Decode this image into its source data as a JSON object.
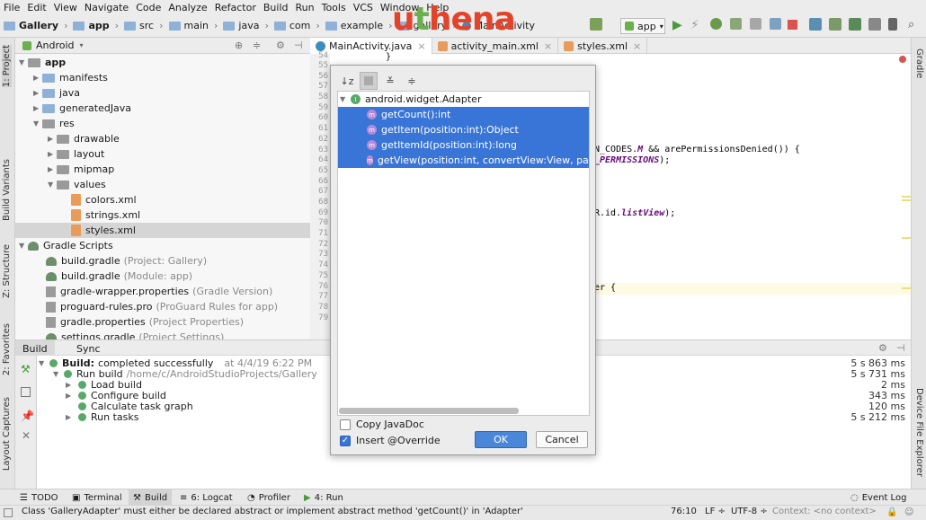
{
  "menu": [
    "File",
    "Edit",
    "View",
    "Navigate",
    "Code",
    "Analyze",
    "Refactor",
    "Build",
    "Run",
    "Tools",
    "VCS",
    "Window",
    "Help"
  ],
  "breadcrumbs": [
    "Gallery",
    "app",
    "src",
    "main",
    "java",
    "com",
    "example",
    "gallery",
    "MainActivity"
  ],
  "logo": {
    "text_main": "u",
    "text_t": "t",
    "text_rest": "hena"
  },
  "toolbar": {
    "run_config": "app"
  },
  "left_strip": {
    "project": "1: Project",
    "build_variants": "Build Variants",
    "structure": "Z: Structure",
    "favorites": "2: Favorites",
    "layout_captures": "Layout Captures"
  },
  "right_strip": {
    "gradle": "Gradle",
    "device_file_explorer": "Device File Explorer"
  },
  "project_panel": {
    "view_selector": "Android",
    "tree": [
      {
        "label": "app",
        "hint": "",
        "icon": "folder",
        "bold": true
      },
      {
        "label": "manifests",
        "hint": "",
        "icon": "folder"
      },
      {
        "label": "java",
        "hint": "",
        "icon": "folder"
      },
      {
        "label": "generatedJava",
        "hint": "",
        "icon": "folder"
      },
      {
        "label": "res",
        "hint": "",
        "icon": "folder"
      },
      {
        "label": "drawable",
        "hint": "",
        "icon": "folder"
      },
      {
        "label": "layout",
        "hint": "",
        "icon": "folder"
      },
      {
        "label": "mipmap",
        "hint": "",
        "icon": "folder"
      },
      {
        "label": "values",
        "hint": "",
        "icon": "folder"
      },
      {
        "label": "colors.xml",
        "hint": "",
        "icon": "xml"
      },
      {
        "label": "strings.xml",
        "hint": "",
        "icon": "xml"
      },
      {
        "label": "styles.xml",
        "hint": "",
        "icon": "xml"
      },
      {
        "label": "Gradle Scripts",
        "hint": "",
        "icon": "gradle"
      },
      {
        "label": "build.gradle",
        "hint": "(Project: Gallery)",
        "icon": "gradle"
      },
      {
        "label": "build.gradle",
        "hint": "(Module: app)",
        "icon": "gradle"
      },
      {
        "label": "gradle-wrapper.properties",
        "hint": "(Gradle Version)",
        "icon": "prop"
      },
      {
        "label": "proguard-rules.pro",
        "hint": "(ProGuard Rules for app)",
        "icon": "prop"
      },
      {
        "label": "gradle.properties",
        "hint": "(Project Properties)",
        "icon": "prop"
      },
      {
        "label": "settings.gradle",
        "hint": "(Project Settings)",
        "icon": "gradle"
      }
    ]
  },
  "editor_tabs": [
    {
      "label": "MainActivity.java",
      "active": true
    },
    {
      "label": "activity_main.xml",
      "active": false
    },
    {
      "label": "styles.xml",
      "active": false
    }
  ],
  "line_numbers": [
    "54",
    "55",
    "56",
    "57",
    "58",
    "59",
    "60",
    "61",
    "62",
    "63",
    "64",
    "65",
    "66",
    "67",
    "68",
    "69",
    "70",
    "71",
    "72",
    "73",
    "74",
    "75",
    "76",
    "77",
    "78",
    "79"
  ],
  "code": {
    "brace": "}",
    "line62a": "N_CODES.",
    "line62b": "M",
    "line62c": " && arePermissionsDenied()) {",
    "line63a": "_PERMISSIONS",
    "line63b": ");",
    "line67a": "R.id.",
    "line67b": "listView",
    "line67c": ");",
    "line76": "er {"
  },
  "dialog": {
    "class_name": "android.widget.Adapter",
    "methods": [
      "getCount():int",
      "getItem(position:int):Object",
      "getItemId(position:int):long",
      "getView(position:int, convertView:View, parent:ViewGroup):View"
    ],
    "copy_javadoc": "Copy JavaDoc",
    "insert_override": "Insert @Override",
    "ok": "OK",
    "cancel": "Cancel"
  },
  "build_panel": {
    "tabs": [
      "Build",
      "Sync"
    ],
    "rows": [
      {
        "label": "Build:",
        "detail": "completed successfully",
        "extra": "at 4/4/19 6:22 PM",
        "time": "5 s 863 ms"
      },
      {
        "label": "Run build",
        "detail": "/home/c/AndroidStudioProjects/Gallery",
        "extra": "",
        "time": "5 s 731 ms"
      },
      {
        "label": "Load build",
        "detail": "",
        "extra": "",
        "time": "2 ms"
      },
      {
        "label": "Configure build",
        "detail": "",
        "extra": "",
        "time": "343 ms"
      },
      {
        "label": "Calculate task graph",
        "detail": "",
        "extra": "",
        "time": "120 ms"
      },
      {
        "label": "Run tasks",
        "detail": "",
        "extra": "",
        "time": "5 s 212 ms"
      }
    ]
  },
  "tool_windows": [
    {
      "label": "TODO"
    },
    {
      "label": "Terminal"
    },
    {
      "label": "Build"
    },
    {
      "label": "6: Logcat"
    },
    {
      "label": "Profiler"
    },
    {
      "label": "4: Run"
    }
  ],
  "event_log": "Event Log",
  "status": {
    "message": "Class 'GalleryAdapter' must either be declared abstract or implement abstract method 'getCount()' in 'Adapter'",
    "position": "76:10",
    "line_sep": "LF ÷",
    "encoding": "UTF-8 ÷",
    "context": "Context: <no context>"
  },
  "colors": {
    "selection": "#3875d7",
    "accent_green": "#59a869",
    "logo_red": "#e2432a"
  }
}
